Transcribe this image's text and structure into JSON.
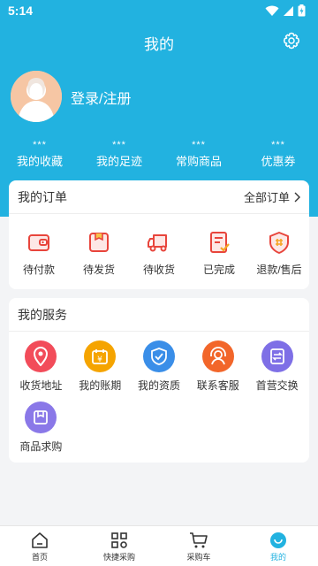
{
  "status": {
    "time": "5:14"
  },
  "header": {
    "title": "我的"
  },
  "profile": {
    "login_label": "登录/注册"
  },
  "stats": [
    {
      "value": "***",
      "label": "我的收藏"
    },
    {
      "value": "***",
      "label": "我的足迹"
    },
    {
      "value": "***",
      "label": "常购商品"
    },
    {
      "value": "***",
      "label": "优惠券"
    }
  ],
  "orders": {
    "title": "我的订单",
    "all_label": "全部订单",
    "items": [
      {
        "label": "待付款",
        "icon": "wallet-icon"
      },
      {
        "label": "待发货",
        "icon": "box-icon"
      },
      {
        "label": "待收货",
        "icon": "truck-icon"
      },
      {
        "label": "已完成",
        "icon": "completed-doc-icon"
      },
      {
        "label": "退款/售后",
        "icon": "after-sale-shield-icon"
      }
    ]
  },
  "services": {
    "title": "我的服务",
    "items": [
      {
        "label": "收货地址",
        "icon": "location-icon",
        "color": "#f24c5a"
      },
      {
        "label": "我的账期",
        "icon": "calendar-yen-icon",
        "color": "#f5a400"
      },
      {
        "label": "我的资质",
        "icon": "shield-check-icon",
        "color": "#3a8ee8"
      },
      {
        "label": "联系客服",
        "icon": "customer-service-icon",
        "color": "#f2662a"
      },
      {
        "label": "首营交换",
        "icon": "exchange-doc-icon",
        "color": "#7e6fe6"
      },
      {
        "label": "商品求购",
        "icon": "product-box-icon",
        "color": "#8a78e8"
      }
    ]
  },
  "tabs": [
    {
      "label": "首页",
      "icon": "home-icon"
    },
    {
      "label": "快捷采购",
      "icon": "grid-icon"
    },
    {
      "label": "采购车",
      "icon": "cart-icon"
    },
    {
      "label": "我的",
      "icon": "profile-icon"
    }
  ],
  "colors": {
    "brand": "#22b2e0",
    "order_icon": "#e8453c"
  }
}
